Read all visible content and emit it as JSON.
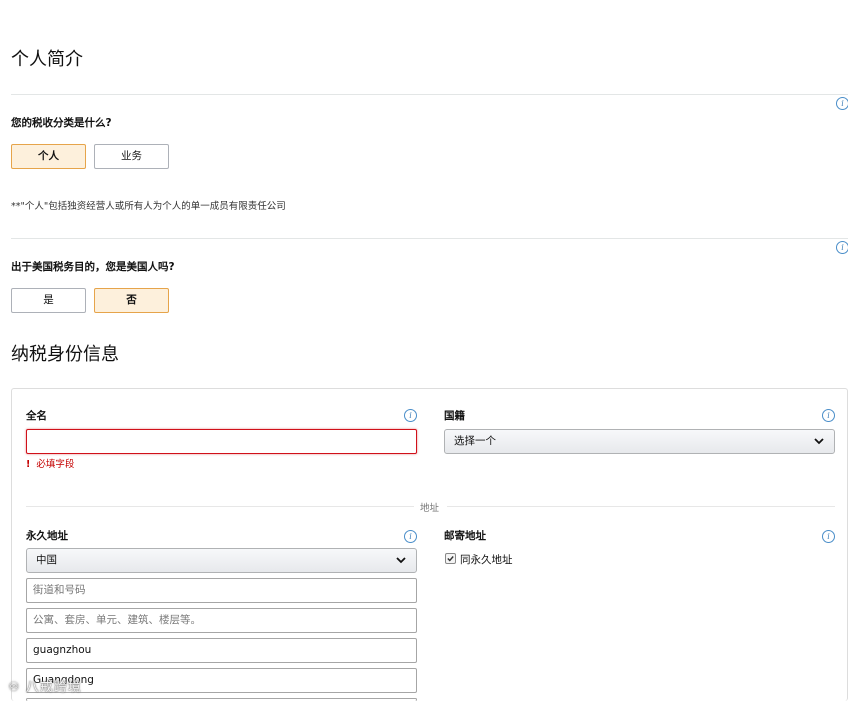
{
  "profile": {
    "title": "个人简介",
    "tax_class_question": "您的税收分类是什么?",
    "tax_class_options": [
      "个人",
      "业务"
    ],
    "tax_class_selected": "个人",
    "tax_class_note": "**\"个人\"包括独资经营人或所有人为个人的单一成员有限责任公司",
    "us_person_question": "出于美国税务目的，您是美国人吗?",
    "us_person_options": [
      "是",
      "否"
    ],
    "us_person_selected": "否"
  },
  "tax_identity": {
    "title": "纳税身份信息",
    "full_name_label": "全名",
    "full_name_value": "",
    "full_name_error": "必填字段",
    "nationality_label": "国籍",
    "nationality_value": "选择一个",
    "address_divider": "地址",
    "permanent_address_label": "永久地址",
    "country_value": "中国",
    "street_placeholder": "街道和号码",
    "apartment_placeholder": "公寓、套房、单元、建筑、楼层等。",
    "city_value": "guagnzhou",
    "province_value": "Guangdong",
    "mailing_address_label": "邮寄地址",
    "same_as_permanent_label": "同永久地址",
    "same_as_permanent_checked": true
  },
  "icons": {
    "info": "info-icon",
    "chevron": "chevron-down-icon",
    "error": "error-icon",
    "checkbox": "checkbox-checked-icon"
  },
  "colors": {
    "selected_bg": "#fdf0dc",
    "selected_border": "#e6a44a",
    "error": "#d0111a",
    "info": "#3f7fb8"
  },
  "watermark": "八戒跨境"
}
